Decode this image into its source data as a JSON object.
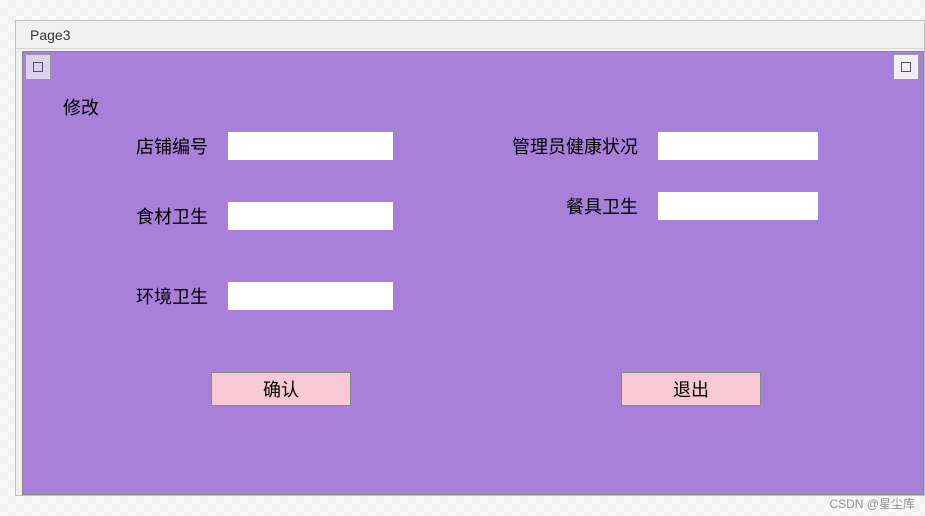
{
  "window": {
    "title": "Page3"
  },
  "section": {
    "title": "修改"
  },
  "fields": {
    "shop_id": {
      "label": "店铺编号",
      "value": ""
    },
    "food": {
      "label": "食材卫生",
      "value": ""
    },
    "env": {
      "label": "环境卫生",
      "value": ""
    },
    "manager": {
      "label": "管理员健康状况",
      "value": ""
    },
    "dishware": {
      "label": "餐具卫生",
      "value": ""
    }
  },
  "buttons": {
    "confirm": "确认",
    "exit": "退出"
  },
  "watermark": "CSDN @星尘库"
}
